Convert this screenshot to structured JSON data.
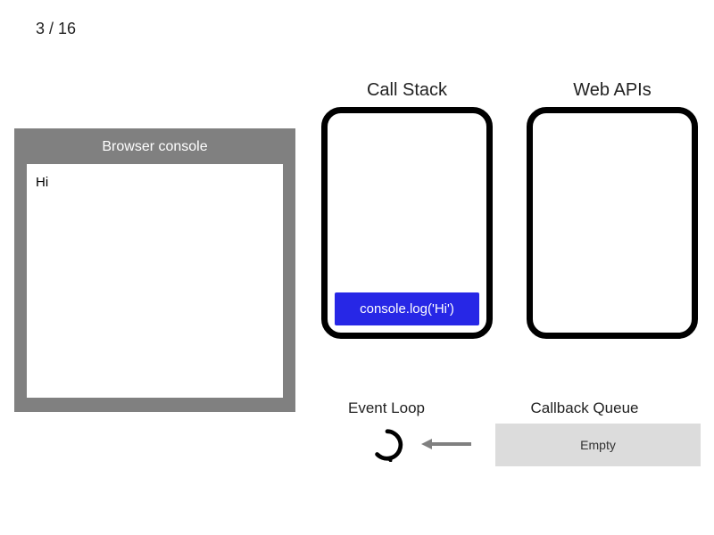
{
  "step": {
    "current": 3,
    "total": 16,
    "label": "3 / 16"
  },
  "console": {
    "title": "Browser console",
    "lines": [
      "Hi"
    ]
  },
  "headings": {
    "callstack": "Call Stack",
    "webapis": "Web APIs",
    "eventloop": "Event Loop",
    "cbqueue": "Callback Queue"
  },
  "callstack": {
    "frames": [
      "console.log('Hi')"
    ]
  },
  "webapis": {
    "items": []
  },
  "callback_queue": {
    "empty_label": "Empty",
    "items": []
  },
  "colors": {
    "frame_bg": "#2727e6",
    "console_chrome": "#808080",
    "queue_bg": "#dcdcdc"
  }
}
